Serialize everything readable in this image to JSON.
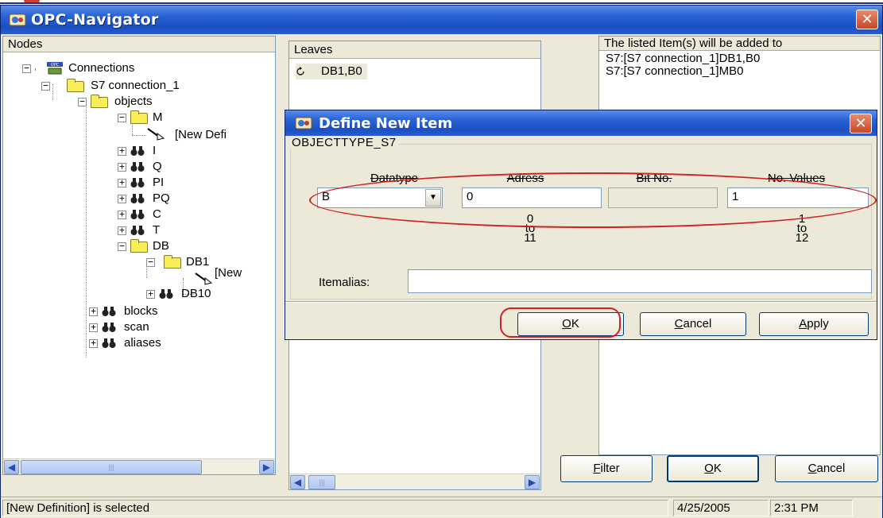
{
  "window": {
    "title": "OPC-Navigator",
    "close_glyph": "✕"
  },
  "nodes_pane": {
    "header": "Nodes",
    "tree": [
      {
        "label": "Connections",
        "icon": "opc-connections-icon"
      },
      {
        "label": "S7 connection_1",
        "icon": "folder-icon"
      },
      {
        "label": "objects",
        "icon": "folder-icon"
      },
      {
        "label": "M",
        "icon": "folder-icon"
      },
      {
        "label": "[New Defi",
        "icon": "new-definition-icon"
      },
      {
        "label": "I",
        "icon": "binoculars-icon"
      },
      {
        "label": "Q",
        "icon": "binoculars-icon"
      },
      {
        "label": "PI",
        "icon": "binoculars-icon"
      },
      {
        "label": "PQ",
        "icon": "binoculars-icon"
      },
      {
        "label": "C",
        "icon": "binoculars-icon"
      },
      {
        "label": "T",
        "icon": "binoculars-icon"
      },
      {
        "label": "DB",
        "icon": "folder-icon"
      },
      {
        "label": "DB1",
        "icon": "folder-icon"
      },
      {
        "label": "[New",
        "icon": "new-definition-icon"
      },
      {
        "label": "DB10",
        "icon": "binoculars-icon"
      },
      {
        "label": "blocks",
        "icon": "binoculars-icon"
      },
      {
        "label": "scan",
        "icon": "binoculars-icon"
      },
      {
        "label": "aliases",
        "icon": "binoculars-icon"
      }
    ]
  },
  "leaves_pane": {
    "header": "Leaves",
    "items": [
      {
        "label": "DB1,B0"
      }
    ]
  },
  "items_pane": {
    "header": "The listed Item(s) will be added to",
    "items": [
      "S7:[S7 connection_1]DB1,B0",
      "S7:[S7 connection_1]MB0"
    ]
  },
  "main_buttons": {
    "filter": {
      "accel": "F",
      "rest": "ilter"
    },
    "ok": {
      "accel": "O",
      "rest": "K"
    },
    "cancel": {
      "accel": "C",
      "rest": "ancel"
    }
  },
  "status": {
    "message": "[New Definition] is selected",
    "date": "4/25/2005",
    "time": "2:31 PM"
  },
  "dialog": {
    "title": "Define New Item",
    "group_label": "OBJECTTYPE_S7",
    "columns": {
      "datatype": "Datatype",
      "adress": "Adress",
      "bit_no": "Bit No.",
      "no_values": "No. Values"
    },
    "datatype_value": "B",
    "adress_value": "0",
    "bit_no_value": "",
    "no_values_value": "1",
    "adress_range": {
      "min": "0",
      "to": "to",
      "max": "11"
    },
    "no_values_range": {
      "min": "1",
      "to": "to",
      "max": "12"
    },
    "itemalias_label": "Itemalias:",
    "itemalias_value": "",
    "buttons": {
      "ok": {
        "accel": "O",
        "rest": "K"
      },
      "cancel": {
        "accel": "C",
        "rest": "ancel"
      },
      "apply": {
        "accel": "A",
        "rest": "pply"
      }
    }
  },
  "colors": {
    "titlebar": "#2a64d6",
    "highlight_ellipse": "#d02020",
    "folder": "#f7ee5a"
  }
}
